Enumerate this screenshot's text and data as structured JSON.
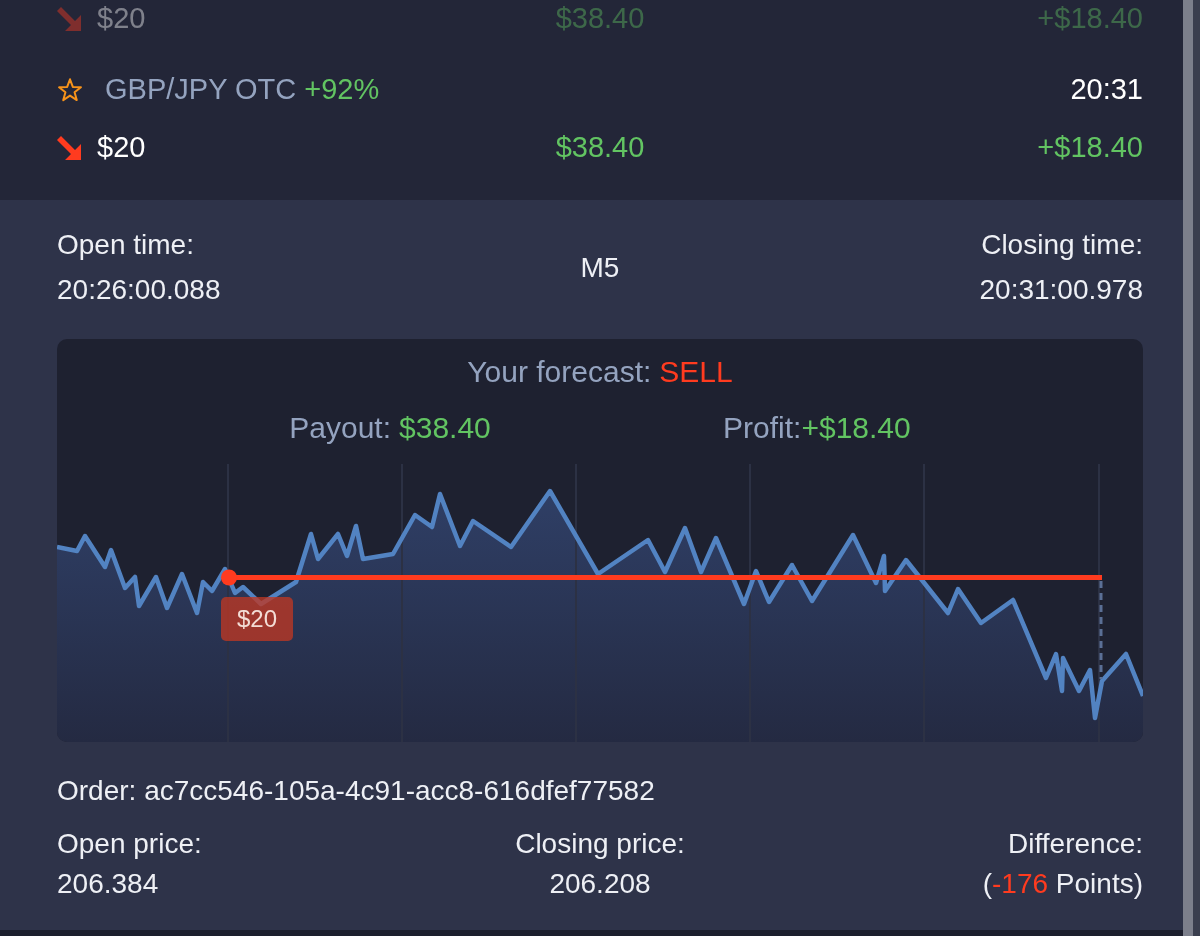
{
  "previous_trade": {
    "kind": "sell",
    "amount": "$20",
    "payout": "$38.40",
    "profit": "+$18.40"
  },
  "trade": {
    "favorite": false,
    "asset": "GBP/JPY OTC",
    "payout_percent": "+92%",
    "close_time": "20:31",
    "kind": "sell",
    "amount": "$20",
    "payout": "$38.40",
    "profit": "+$18.40"
  },
  "times": {
    "open_label": "Open time:",
    "open": "20:26:00.088",
    "timeframe": "M5",
    "close_label": "Closing time:",
    "close": "20:31:00.978"
  },
  "forecast": {
    "label": "Your forecast:",
    "value": "SELL",
    "kind": "sell"
  },
  "payout": {
    "label": "Payout:",
    "value": "$38.40"
  },
  "profit": {
    "label": "Profit:",
    "value": "+$18.40"
  },
  "chart": {
    "amount_tag": "$20"
  },
  "order": "Order: ac7cc546-105a-4c91-acc8-616dfef77582",
  "prices": {
    "open_label": "Open price:",
    "open": "206.384",
    "close_label": "Closing price:",
    "close": "206.208",
    "difference_label": "Difference:",
    "difference": {
      "before": "(",
      "value": "-176",
      "after": " Points)"
    }
  }
}
